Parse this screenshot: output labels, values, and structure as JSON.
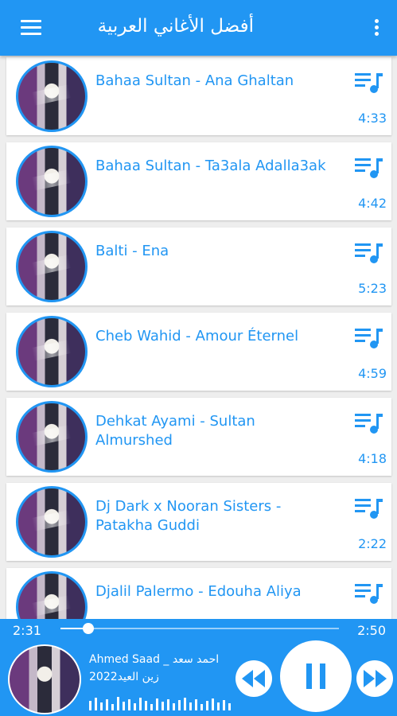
{
  "app": {
    "title": "أفضل الأغاني العربية"
  },
  "songs": [
    {
      "title": "Bahaa Sultan - Ana Ghaltan",
      "duration": "4:33"
    },
    {
      "title": "Bahaa Sultan - Ta3ala Adalla3ak",
      "duration": "4:42"
    },
    {
      "title": "Balti - Ena",
      "duration": "5:23"
    },
    {
      "title": "Cheb Wahid - Amour Éternel",
      "duration": "4:59"
    },
    {
      "title": "Dehkat Ayami - Sultan Almurshed",
      "duration": "4:18"
    },
    {
      "title": "Dj Dark x Nooran Sisters - Patakha Guddi",
      "duration": "2:22"
    },
    {
      "title": "Djalil Palermo - Edouha Aliya",
      "duration": ""
    }
  ],
  "player": {
    "current_time": "2:31",
    "total_time": "2:50",
    "progress": 0.1,
    "now_playing_line1": "Ahmed Saad _ احمد سعد",
    "now_playing_line2": "زين العيد2022"
  },
  "colors": {
    "accent": "#2196f3",
    "background": "#eeeeee",
    "card": "#ffffff"
  },
  "icons": [
    "menu-icon",
    "more-vert-icon",
    "queue-music-icon",
    "skip-previous-icon",
    "pause-icon",
    "skip-next-icon",
    "audio-visualizer-icon"
  ]
}
